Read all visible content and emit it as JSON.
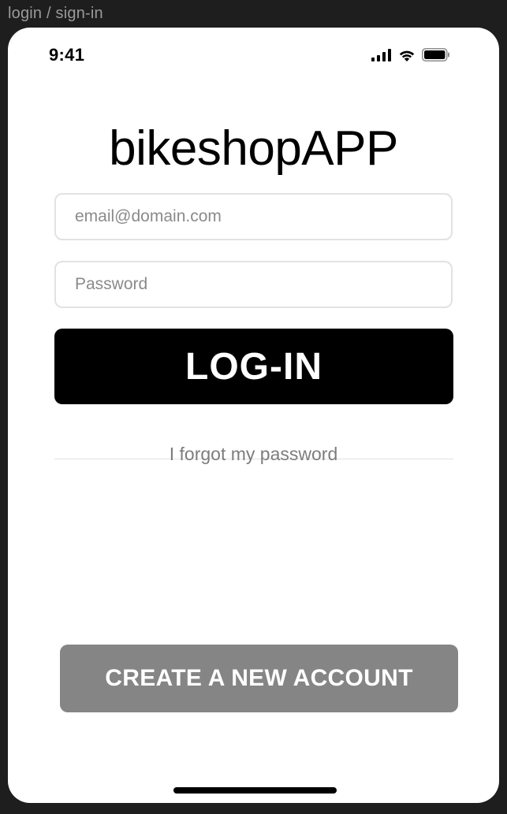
{
  "frame": {
    "label": "login / sign-in"
  },
  "status_bar": {
    "time": "9:41",
    "icons": [
      "cellular-signal-icon",
      "wifi-icon",
      "battery-icon"
    ]
  },
  "app": {
    "title": "bikeshopAPP"
  },
  "form": {
    "email_placeholder": "email@domain.com",
    "email_value": "",
    "password_placeholder": "Password",
    "password_value": "",
    "login_label": "LOG-IN",
    "forgot_label": "I forgot my password"
  },
  "footer": {
    "create_account_label": "CREATE A NEW ACCOUNT"
  },
  "colors": {
    "background": "#1e1e1e",
    "screen": "#ffffff",
    "primary_button": "#000000",
    "secondary_button": "#858585",
    "input_border": "#e2e2e2",
    "muted_text": "#7d7d7d"
  }
}
